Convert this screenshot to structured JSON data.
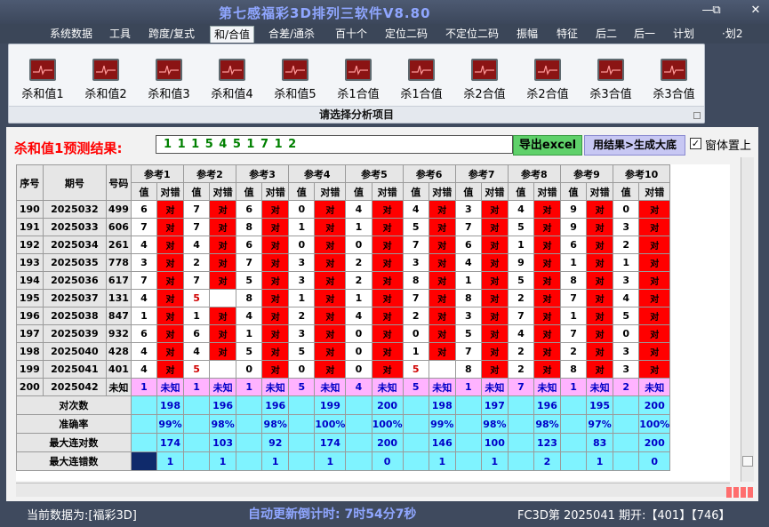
{
  "window": {
    "title": "第七感福彩3D排列三软件V8.80"
  },
  "menu": [
    "系统数据",
    "工具",
    "跨度/复式",
    "和/合值",
    "合差/通杀",
    "百十个",
    "定位二码",
    "不定位二码",
    "振幅",
    "特征",
    "后二",
    "后一",
    "计划",
    "·划2"
  ],
  "menu_active": "和/合值",
  "ribbon": {
    "buttons": [
      "杀和值1",
      "杀和值2",
      "杀和值3",
      "杀和值4",
      "杀和值5",
      "杀1合值",
      "杀1合值",
      "杀2合值",
      "杀2合值",
      "杀3合值",
      "杀3合值"
    ],
    "caption": "请选择分析项目"
  },
  "prediction": {
    "label": "杀和值1预测结果:",
    "value": "1 1 1 5 4 5 1 7 1 2",
    "export_label": "导出excel",
    "generate_label": "用结果>生成大底",
    "checkbox_label": "窗体置上",
    "checkbox_checked": true
  },
  "table": {
    "headers": {
      "seq": "序号",
      "issue": "期号",
      "code": "号码",
      "ref_prefix": "参考",
      "val": "值",
      "hit": "对错"
    },
    "ref_count": 10,
    "rows": [
      {
        "seq": "190",
        "issue": "2025032",
        "code": "499",
        "cells": [
          [
            "6",
            "对"
          ],
          [
            "7",
            "对"
          ],
          [
            "6",
            "对"
          ],
          [
            "0",
            "对"
          ],
          [
            "4",
            "对"
          ],
          [
            "4",
            "对"
          ],
          [
            "3",
            "对"
          ],
          [
            "4",
            "对"
          ],
          [
            "9",
            "对"
          ],
          [
            "0",
            "对"
          ]
        ]
      },
      {
        "seq": "191",
        "issue": "2025033",
        "code": "606",
        "cells": [
          [
            "7",
            "对"
          ],
          [
            "7",
            "对"
          ],
          [
            "8",
            "对"
          ],
          [
            "1",
            "对"
          ],
          [
            "1",
            "对"
          ],
          [
            "5",
            "对"
          ],
          [
            "7",
            "对"
          ],
          [
            "5",
            "对"
          ],
          [
            "9",
            "对"
          ],
          [
            "3",
            "对"
          ]
        ]
      },
      {
        "seq": "192",
        "issue": "2025034",
        "code": "261",
        "cells": [
          [
            "4",
            "对"
          ],
          [
            "4",
            "对"
          ],
          [
            "6",
            "对"
          ],
          [
            "0",
            "对"
          ],
          [
            "0",
            "对"
          ],
          [
            "7",
            "对"
          ],
          [
            "6",
            "对"
          ],
          [
            "1",
            "对"
          ],
          [
            "6",
            "对"
          ],
          [
            "2",
            "对"
          ]
        ]
      },
      {
        "seq": "193",
        "issue": "2025035",
        "code": "778",
        "cells": [
          [
            "3",
            "对"
          ],
          [
            "2",
            "对"
          ],
          [
            "7",
            "对"
          ],
          [
            "3",
            "对"
          ],
          [
            "2",
            "对"
          ],
          [
            "3",
            "对"
          ],
          [
            "4",
            "对"
          ],
          [
            "9",
            "对"
          ],
          [
            "1",
            "对"
          ],
          [
            "1",
            "对"
          ]
        ]
      },
      {
        "seq": "194",
        "issue": "2025036",
        "code": "617",
        "cells": [
          [
            "7",
            "对"
          ],
          [
            "7",
            "对"
          ],
          [
            "5",
            "对"
          ],
          [
            "3",
            "对"
          ],
          [
            "2",
            "对"
          ],
          [
            "8",
            "对"
          ],
          [
            "1",
            "对"
          ],
          [
            "5",
            "对"
          ],
          [
            "8",
            "对"
          ],
          [
            "3",
            "对"
          ]
        ]
      },
      {
        "seq": "195",
        "issue": "2025037",
        "code": "131",
        "cells": [
          [
            "4",
            "对"
          ],
          [
            "5",
            ""
          ],
          [
            "8",
            "对"
          ],
          [
            "1",
            "对"
          ],
          [
            "1",
            "对"
          ],
          [
            "7",
            "对"
          ],
          [
            "8",
            "对"
          ],
          [
            "2",
            "对"
          ],
          [
            "7",
            "对"
          ],
          [
            "4",
            "对"
          ]
        ]
      },
      {
        "seq": "196",
        "issue": "2025038",
        "code": "847",
        "cells": [
          [
            "1",
            "对"
          ],
          [
            "1",
            "对"
          ],
          [
            "4",
            "对"
          ],
          [
            "2",
            "对"
          ],
          [
            "4",
            "对"
          ],
          [
            "2",
            "对"
          ],
          [
            "3",
            "对"
          ],
          [
            "7",
            "对"
          ],
          [
            "1",
            "对"
          ],
          [
            "5",
            "对"
          ]
        ]
      },
      {
        "seq": "197",
        "issue": "2025039",
        "code": "932",
        "cells": [
          [
            "6",
            "对"
          ],
          [
            "6",
            "对"
          ],
          [
            "1",
            "对"
          ],
          [
            "3",
            "对"
          ],
          [
            "0",
            "对"
          ],
          [
            "0",
            "对"
          ],
          [
            "5",
            "对"
          ],
          [
            "4",
            "对"
          ],
          [
            "7",
            "对"
          ],
          [
            "0",
            "对"
          ]
        ]
      },
      {
        "seq": "198",
        "issue": "2025040",
        "code": "428",
        "cells": [
          [
            "4",
            "对"
          ],
          [
            "4",
            "对"
          ],
          [
            "5",
            "对"
          ],
          [
            "5",
            "对"
          ],
          [
            "0",
            "对"
          ],
          [
            "1",
            "对"
          ],
          [
            "7",
            "对"
          ],
          [
            "2",
            "对"
          ],
          [
            "2",
            "对"
          ],
          [
            "3",
            "对"
          ]
        ]
      },
      {
        "seq": "199",
        "issue": "2025041",
        "code": "401",
        "cells": [
          [
            "4",
            "对"
          ],
          [
            "5",
            ""
          ],
          [
            "0",
            "对"
          ],
          [
            "0",
            "对"
          ],
          [
            "0",
            "对"
          ],
          [
            "5",
            ""
          ],
          [
            "8",
            "对"
          ],
          [
            "2",
            "对"
          ],
          [
            "8",
            "对"
          ],
          [
            "3",
            "对"
          ]
        ]
      }
    ],
    "future": {
      "seq": "200",
      "issue": "2025042",
      "code": "未知",
      "cells": [
        [
          "1",
          "未知"
        ],
        [
          "1",
          "未知"
        ],
        [
          "1",
          "未知"
        ],
        [
          "5",
          "未知"
        ],
        [
          "4",
          "未知"
        ],
        [
          "5",
          "未知"
        ],
        [
          "1",
          "未知"
        ],
        [
          "7",
          "未知"
        ],
        [
          "1",
          "未知"
        ],
        [
          "2",
          "未知"
        ]
      ]
    },
    "stats": [
      {
        "label": "对次数",
        "values": [
          "198",
          "196",
          "196",
          "199",
          "200",
          "198",
          "197",
          "196",
          "195",
          "200"
        ]
      },
      {
        "label": "准确率",
        "values": [
          "99%",
          "98%",
          "98%",
          "100%",
          "100%",
          "99%",
          "98%",
          "98%",
          "97%",
          "100%"
        ]
      },
      {
        "label": "最大连对数",
        "values": [
          "174",
          "103",
          "92",
          "174",
          "200",
          "146",
          "100",
          "123",
          "83",
          "200"
        ]
      },
      {
        "label": "最大连错数",
        "values": [
          "1",
          "1",
          "1",
          "1",
          "0",
          "1",
          "1",
          "2",
          "1",
          "0"
        ]
      }
    ]
  },
  "status": {
    "data": "当前数据为:[福彩3D]",
    "countdown": "自动更新倒计时:  7时54分7秒",
    "issue": "FC3D第 2025041 期开:【401】【746】"
  },
  "colors": {
    "hit": "#ff0000",
    "future": "#ffb3ff",
    "stats": "#7ff3ff",
    "accent": "#8fa6ff"
  }
}
